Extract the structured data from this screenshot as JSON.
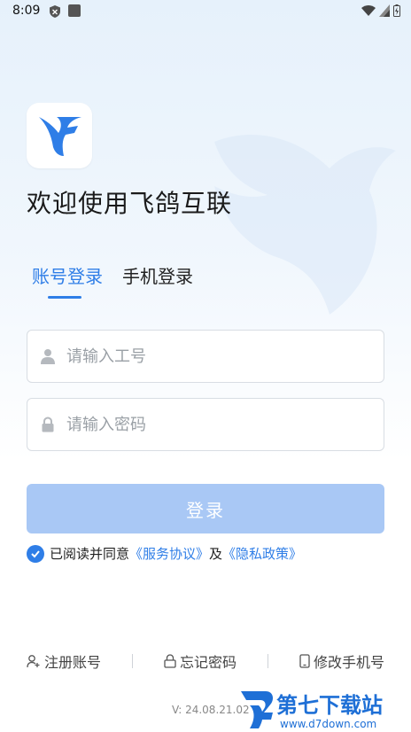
{
  "status_bar": {
    "time": "8:09"
  },
  "header": {
    "title": "欢迎使用飞鸽互联"
  },
  "tabs": [
    {
      "label": "账号登录",
      "active": true
    },
    {
      "label": "手机登录",
      "active": false
    }
  ],
  "form": {
    "username_placeholder": "请输入工号",
    "password_placeholder": "请输入密码",
    "login_label": "登录"
  },
  "agreement": {
    "prefix": "已阅读并同意",
    "terms": "《服务协议》",
    "and": "及",
    "privacy": "《隐私政策》",
    "checked": true
  },
  "footer": {
    "register": "注册账号",
    "forgot": "忘记密码",
    "change_phone": "修改手机号",
    "version": "V: 24.08.21.02"
  },
  "watermark": {
    "brand": "第七下载站",
    "url": "www.d7down.com"
  },
  "colors": {
    "accent": "#2f7ee7",
    "button_disabled": "#a9c8f5"
  }
}
